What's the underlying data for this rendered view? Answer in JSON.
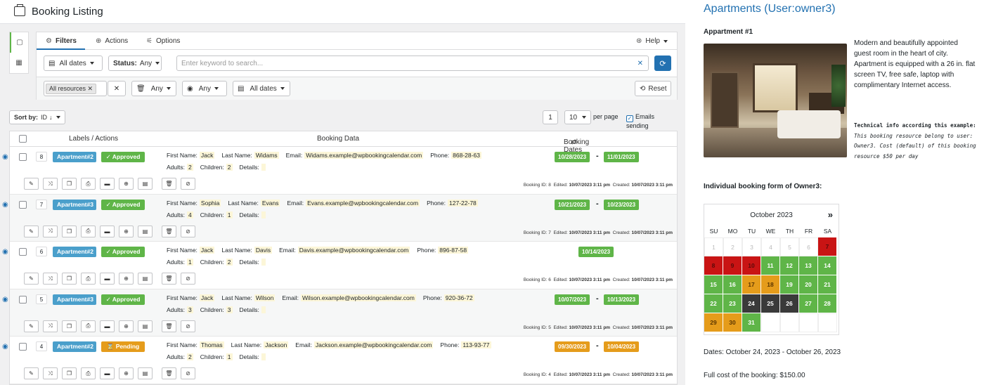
{
  "header": {
    "title": "Booking Listing"
  },
  "tabs": [
    {
      "label": "Filters",
      "icon": "sliders-icon"
    },
    {
      "label": "Actions",
      "icon": "plus-circle-icon"
    },
    {
      "label": "Options",
      "icon": "options-icon"
    }
  ],
  "help": {
    "label": "Help"
  },
  "filters": {
    "dates_label": "All dates",
    "status_label": "Status:",
    "status_value": "Any",
    "search_placeholder": "Enter keyword to search...",
    "resources_tag": "All resources",
    "any1": "Any",
    "any2": "Any",
    "dates2": "All dates",
    "reset": "Reset"
  },
  "sort": {
    "label": "Sort by:",
    "value": "ID",
    "page": "1",
    "per_page": "10",
    "per_page_label": "per page",
    "emails": "Emails sending"
  },
  "columns": {
    "labels": "Labels / Actions",
    "data": "Booking Data",
    "dates": "Booking Dates"
  },
  "bookings": [
    {
      "id": "8",
      "resource": "Apartment#2",
      "status": "Approved",
      "first": "Jack",
      "last": "Widams",
      "email": "Widams.example@wpbookingcalendar.com",
      "phone": "868-28-63",
      "adults": "2",
      "children": "2",
      "d1": "10/28/2023",
      "d2": "11/01/2023",
      "meta_id": "Booking ID: 8",
      "edited": "10/07/2023 3:11 pm",
      "created": "10/07/2023 3:11 pm"
    },
    {
      "id": "7",
      "resource": "Apartment#3",
      "status": "Approved",
      "first": "Sophia",
      "last": "Evans",
      "email": "Evans.example@wpbookingcalendar.com",
      "phone": "127-22-78",
      "adults": "4",
      "children": "1",
      "d1": "10/21/2023",
      "d2": "10/23/2023",
      "meta_id": "Booking ID: 7",
      "edited": "10/07/2023 3:11 pm",
      "created": "10/07/2023 3:11 pm"
    },
    {
      "id": "6",
      "resource": "Apartment#2",
      "status": "Approved",
      "first": "Jack",
      "last": "Davis",
      "email": "Davis.example@wpbookingcalendar.com",
      "phone": "896-87-58",
      "adults": "1",
      "children": "2",
      "d1": "10/14/2023",
      "d2": "",
      "meta_id": "Booking ID: 6",
      "edited": "10/07/2023 3:11 pm",
      "created": "10/07/2023 3:11 pm"
    },
    {
      "id": "5",
      "resource": "Apartment#3",
      "status": "Approved",
      "first": "Jack",
      "last": "Wilson",
      "email": "Wilson.example@wpbookingcalendar.com",
      "phone": "920-36-72",
      "adults": "3",
      "children": "3",
      "d1": "10/07/2023",
      "d2": "10/13/2023",
      "meta_id": "Booking ID: 5",
      "edited": "10/07/2023 3:11 pm",
      "created": "10/07/2023 3:11 pm"
    },
    {
      "id": "4",
      "resource": "Apartment#2",
      "status": "Pending",
      "first": "Thomas",
      "last": "Jackson",
      "email": "Jackson.example@wpbookingcalendar.com",
      "phone": "113-93-77",
      "adults": "2",
      "children": "1",
      "d1": "09/30/2023",
      "d2": "10/04/2023",
      "meta_id": "Booking ID: 4",
      "edited": "10/07/2023 3:11 pm",
      "created": "10/07/2023 3:11 pm"
    }
  ],
  "labels": {
    "first": "First Name:",
    "last": "Last Name:",
    "email": "Email:",
    "phone": "Phone:",
    "adults": "Adults:",
    "children": "Children:",
    "details": "Details:",
    "edited": "Edited:",
    "created": "Created:"
  },
  "right": {
    "title": "Apartments (User:owner3)",
    "sub": "Appartment #1",
    "desc": "Modern and beautifully appointed guest room in the heart of city. Apartment is equipped with a 26 in. flat screen TV, free safe, laptop with complimentary Internet access.",
    "tech_head": "Technical info according this example:",
    "tech_body": "This booking resource belong to user: Owner3. Cost (default) of this booking resource $50 per day",
    "form_title": "Individual booking form of Owner3:",
    "month": "October 2023",
    "next": "»",
    "dows": [
      "SU",
      "MO",
      "TU",
      "WE",
      "TH",
      "FR",
      "SA"
    ],
    "dates": "Dates: October 24, 2023 - October 26, 2023",
    "cost": "Full cost of the booking: $150.00"
  },
  "calendar": [
    {
      "n": "1",
      "s": "past"
    },
    {
      "n": "2",
      "s": "past"
    },
    {
      "n": "3",
      "s": "past"
    },
    {
      "n": "4",
      "s": "past"
    },
    {
      "n": "5",
      "s": "past"
    },
    {
      "n": "6",
      "s": "past"
    },
    {
      "n": "7",
      "s": "bk"
    },
    {
      "n": "8",
      "s": "bk"
    },
    {
      "n": "9",
      "s": "bk"
    },
    {
      "n": "10",
      "s": "bk"
    },
    {
      "n": "11",
      "s": "av"
    },
    {
      "n": "12",
      "s": "av"
    },
    {
      "n": "13",
      "s": "av"
    },
    {
      "n": "14",
      "s": "av"
    },
    {
      "n": "15",
      "s": "av"
    },
    {
      "n": "16",
      "s": "av"
    },
    {
      "n": "17",
      "s": "pd"
    },
    {
      "n": "18",
      "s": "pd"
    },
    {
      "n": "19",
      "s": "av"
    },
    {
      "n": "20",
      "s": "av"
    },
    {
      "n": "21",
      "s": "av"
    },
    {
      "n": "22",
      "s": "av"
    },
    {
      "n": "23",
      "s": "av"
    },
    {
      "n": "24",
      "s": "sel"
    },
    {
      "n": "25",
      "s": "sel"
    },
    {
      "n": "26",
      "s": "sel"
    },
    {
      "n": "27",
      "s": "av"
    },
    {
      "n": "28",
      "s": "av"
    },
    {
      "n": "29",
      "s": "pd"
    },
    {
      "n": "30",
      "s": "pd"
    },
    {
      "n": "31",
      "s": "av"
    },
    {
      "n": "",
      "s": "em"
    },
    {
      "n": "",
      "s": "em"
    },
    {
      "n": "",
      "s": "em"
    },
    {
      "n": "",
      "s": "em"
    }
  ],
  "colors": {
    "approved": "#5fb548",
    "pending": "#e59c1b",
    "resource": "#4a9fcb",
    "booked": "#c91414",
    "accent": "#2271b1"
  }
}
